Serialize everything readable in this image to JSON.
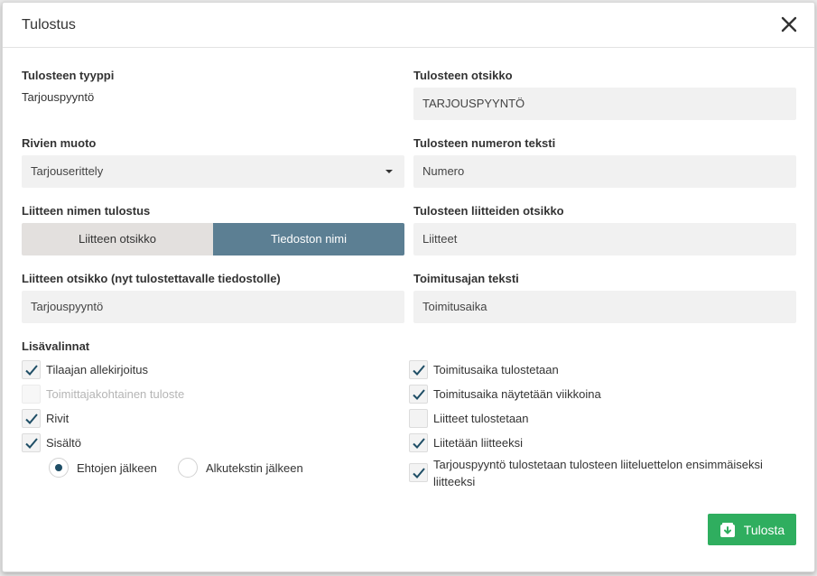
{
  "dialog": {
    "title": "Tulostus",
    "close_icon": "close-icon"
  },
  "left": {
    "print_type": {
      "label": "Tulosteen tyyppi",
      "value": "Tarjouspyyntö"
    },
    "row_format": {
      "label": "Rivien muoto",
      "value": "Tarjouserittely",
      "icon": "chevron-down-icon"
    },
    "attachment_name_print": {
      "label": "Liitteen nimen tulostus",
      "options": [
        "Liitteen otsikko",
        "Tiedoston nimi"
      ],
      "selected": "Tiedoston nimi"
    },
    "attachment_title": {
      "label": "Liitteen otsikko (nyt tulostettavalle tiedostolle)",
      "value": "Tarjouspyyntö"
    }
  },
  "right": {
    "print_title": {
      "label": "Tulosteen otsikko",
      "value": "TARJOUSPYYNTÖ"
    },
    "number_text": {
      "label": "Tulosteen numeron teksti",
      "value": "Numero"
    },
    "attachments_title": {
      "label": "Tulosteen liitteiden otsikko",
      "value": "Liitteet"
    },
    "delivery_text": {
      "label": "Toimitusajan teksti",
      "value": "Toimitusaika"
    }
  },
  "options": {
    "label": "Lisävalinnat",
    "left": [
      {
        "label": "Tilaajan allekirjoitus",
        "checked": true,
        "disabled": false
      },
      {
        "label": "Toimittajakohtainen tuloste",
        "checked": false,
        "disabled": true
      },
      {
        "label": "Rivit",
        "checked": true,
        "disabled": false
      },
      {
        "label": "Sisältö",
        "checked": true,
        "disabled": false
      }
    ],
    "radios": [
      {
        "label": "Ehtojen jälkeen",
        "checked": true
      },
      {
        "label": "Alkutekstin jälkeen",
        "checked": false
      }
    ],
    "right": [
      {
        "label": "Toimitusaika tulostetaan",
        "checked": true
      },
      {
        "label": "Toimitusaika näytetään viikkoina",
        "checked": true
      },
      {
        "label": "Liitteet tulostetaan",
        "checked": false
      },
      {
        "label": "Liitetään liitteeksi",
        "checked": true
      },
      {
        "label": "Tarjouspyyntö tulostetaan tulosteen liiteluettelon ensimmäiseksi liitteeksi",
        "checked": true
      }
    ]
  },
  "footer": {
    "print_button": "Tulosta",
    "print_icon": "download-box-icon"
  },
  "colors": {
    "primary_button": "#2fae5f",
    "segment_active": "#5c7f93",
    "checkmark": "#1f4e66"
  }
}
